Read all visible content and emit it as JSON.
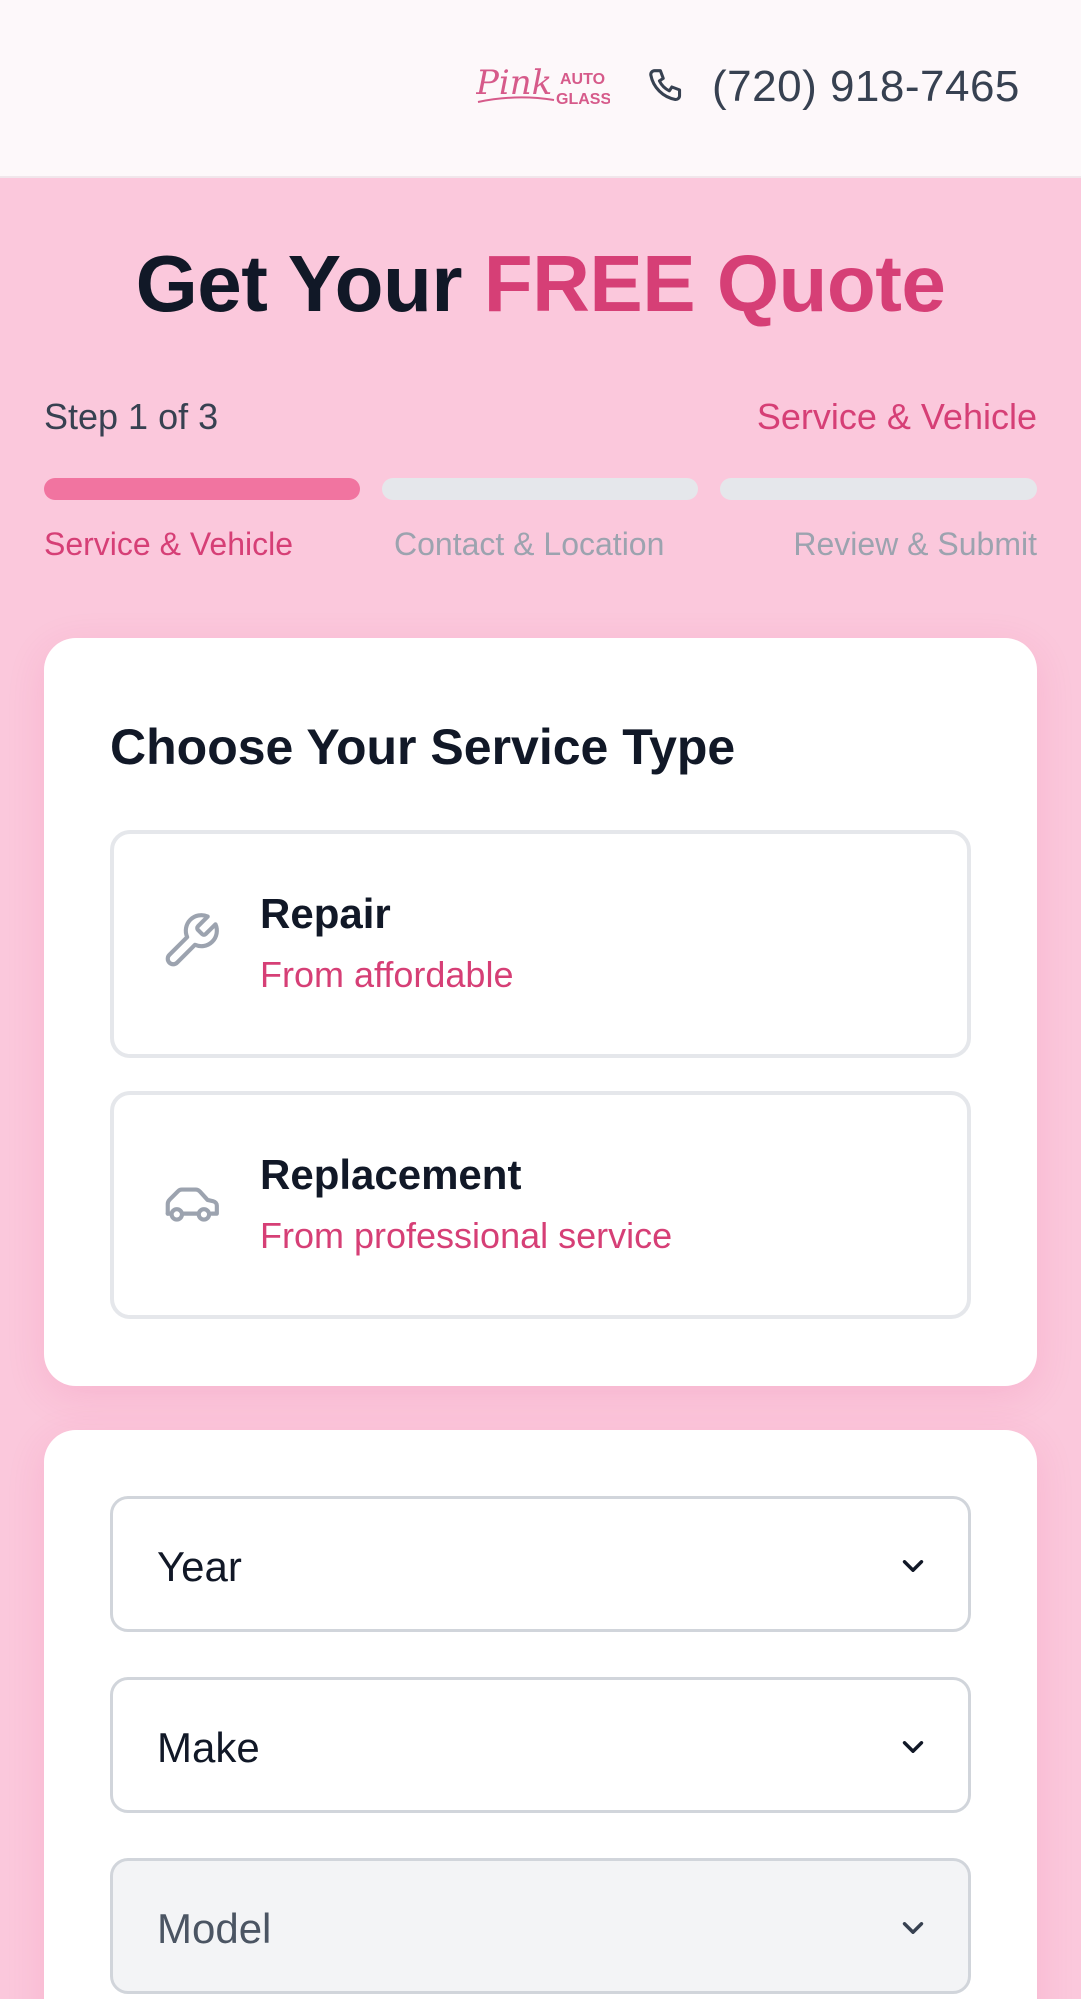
{
  "header": {
    "logo": {
      "script": "Pink",
      "line1": "AUTO",
      "line2": "GLASS"
    },
    "phone_icon": "phone-icon",
    "phone_number": "(720) 918-7465"
  },
  "hero": {
    "title_prefix": "Get Your",
    "title_accent": "FREE Quote"
  },
  "progress": {
    "step_text": "Step 1 of 3",
    "current_step_name": "Service & Vehicle",
    "completed_fraction": 0.333,
    "steps": [
      {
        "label": "Service & Vehicle",
        "active": true
      },
      {
        "label": "Contact & Location",
        "active": false
      },
      {
        "label": "Review & Submit",
        "active": false
      }
    ]
  },
  "service": {
    "heading": "Choose Your Service Type",
    "options": [
      {
        "title": "Repair",
        "subtitle": "From affordable",
        "icon": "wrench-icon"
      },
      {
        "title": "Replacement",
        "subtitle": "From professional service",
        "icon": "car-icon"
      }
    ]
  },
  "vehicle": {
    "year_placeholder": "Year",
    "make_placeholder": "Make",
    "model_placeholder": "Model",
    "model_disabled": true
  },
  "colors": {
    "accent": "#d63f76",
    "progress_active": "#f174a0",
    "background": "#fbc8dc"
  }
}
